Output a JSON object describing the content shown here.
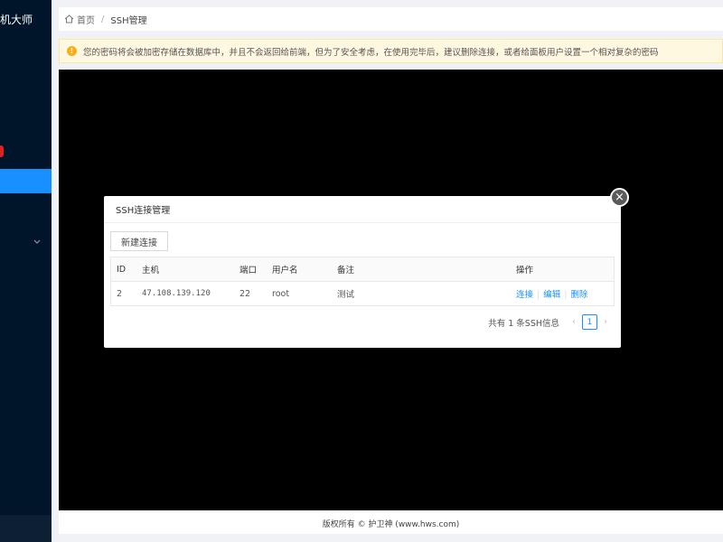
{
  "app": {
    "brand": "机大师"
  },
  "breadcrumb": {
    "home": "首页",
    "separator": "/",
    "current": "SSH管理"
  },
  "alert": {
    "text": "您的密码将会被加密存储在数据库中，并且不会返回给前端，但为了安全考虑，在使用完毕后，建议删除连接，或者给面板用户设置一个相对复杂的密码"
  },
  "modal": {
    "title": "SSH连接管理",
    "close_glyph": "×",
    "new_button": "新建连接",
    "columns": {
      "id": "ID",
      "host": "主机",
      "port": "端口",
      "user": "用户名",
      "note": "备注",
      "ops": "操作"
    },
    "rows": [
      {
        "id": "2",
        "host": "47.108.139.120",
        "port": "22",
        "user": "root",
        "note": "测试",
        "op_connect": "连接",
        "op_edit": "编辑",
        "op_delete": "删除"
      }
    ],
    "pagination": {
      "total_text": "共有 1 条SSH信息",
      "prev": "‹",
      "page": "1",
      "next": "›"
    }
  },
  "footer": {
    "text": "版权所有 © 护卫神 (www.hws.com)"
  },
  "colors": {
    "sidebar": "#001529",
    "accent": "#1890ff",
    "alert_bg": "#fff8e1",
    "warn": "#faad14",
    "badge": "#e02020"
  },
  "icons": {
    "home": "home-icon",
    "warning": "warning-icon",
    "chevron": "chevron-down-icon",
    "close": "close-icon"
  }
}
